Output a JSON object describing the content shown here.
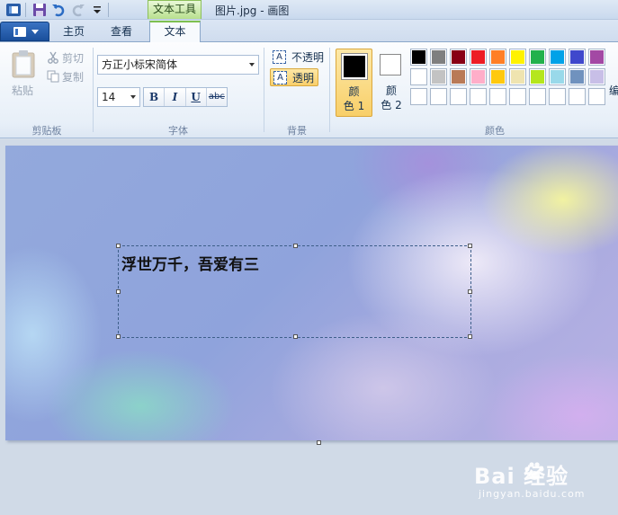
{
  "titlebar": {
    "context_tab": "文本工具",
    "window_title": "图片.jpg - 画图"
  },
  "tabs": [
    {
      "label": "主页"
    },
    {
      "label": "查看"
    },
    {
      "label": "文本",
      "active": true
    }
  ],
  "clipboard": {
    "paste_label": "粘贴",
    "cut_label": "剪切",
    "copy_label": "复制",
    "group_label": "剪贴板"
  },
  "font": {
    "family_value": "方正小标宋简体",
    "size_value": "14",
    "bold_label": "B",
    "italic_label": "I",
    "underline_label": "U",
    "strike_label": "abc",
    "group_label": "字体"
  },
  "background": {
    "opaque_label": "不透明",
    "transparent_label": "透明",
    "group_label": "背景",
    "selected": "transparent"
  },
  "colors": {
    "color1_label_a": "颜",
    "color1_label_b": "色 1",
    "color2_label_a": "颜",
    "color2_label_b": "色 2",
    "color1_value": "#000000",
    "color2_value": "#ffffff",
    "edit_label": "编",
    "group_label": "颜色",
    "palette_row1": [
      "#000000",
      "#7f7f7f",
      "#880015",
      "#ed1c24",
      "#ff7f27",
      "#fff200",
      "#22b14c",
      "#00a2e8",
      "#3f48cc",
      "#a349a4"
    ],
    "palette_row2": [
      "#ffffff",
      "#c3c3c3",
      "#b97a57",
      "#ffaec9",
      "#ffc90e",
      "#efe4b0",
      "#b5e61d",
      "#99d9ea",
      "#7092be",
      "#c8bfe7"
    ]
  },
  "canvas": {
    "text_content": "浮世万千，吾爱有三"
  },
  "watermark": {
    "main": "Bai  经验",
    "sub": "jingyan.baidu.com"
  }
}
